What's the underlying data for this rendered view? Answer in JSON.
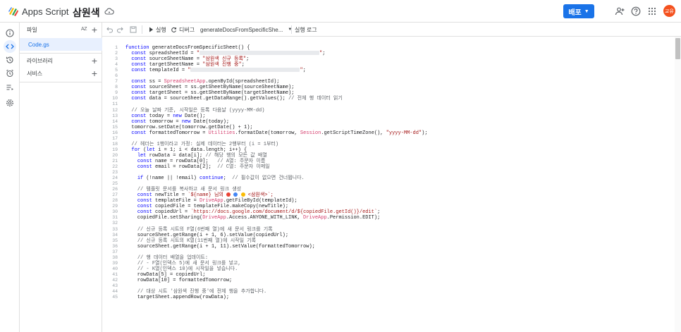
{
  "header": {
    "app_name": "Apps Script",
    "project_name": "삼원색",
    "deploy_label": "배포",
    "avatar_label": "교유"
  },
  "files_panel": {
    "files_label": "파일",
    "sort_label": "AZ",
    "active_file": "Code.gs",
    "libraries_label": "라이브러리",
    "services_label": "서비스"
  },
  "toolbar": {
    "run_label": "실행",
    "debug_label": "디버그",
    "function_name": "generateDocsFromSpecificShe...",
    "exec_log_label": "실행 로그"
  },
  "code_lines": [
    "function generateDocsFromSpecificSheet() {",
    "  const spreadsheetId = \"",
    "  const sourceSheetName = \"삼원색 신규 등록\";",
    "  const targetSheetName = \"삼원색 진행 중\";",
    "  const templateId = \"",
    "",
    "  const ss = SpreadsheetApp.openById(spreadsheetId);",
    "  const sourceSheet = ss.getSheetByName(sourceSheetName);",
    "  const targetSheet = ss.getSheetByName(targetSheetName);",
    "  const data = sourceSheet.getDataRange().getValues(); // 전체 행 데이터 읽기",
    "",
    "  // 오늘 날짜 기준, 시작일은 등록 다음날 (yyyy-MM-dd)",
    "  const today = new Date();",
    "  const tomorrow = new Date(today);",
    "  tomorrow.setDate(tomorrow.getDate() + 1);",
    "  const formattedTomorrow = Utilities.formatDate(tomorrow, Session.getScriptTimeZone(), \"yyyy-MM-dd\");",
    "",
    "  // 헤더는 1행이라고 가정: 실제 데이터는 2행부터 (i = 1부터)",
    "  for (let i = 1; i < data.length; i++) {",
    "    let rowData = data[i]; // 해당 행의 모든 값 배열",
    "    const name = rowData[0];   // A열: 주문자 이름",
    "    const email = rowData[2];  // C열: 주문자 이메일",
    "",
    "    if (!name || !email) continue;  // 필수값이 없으면 건너뜁니다.",
    "",
    "    // 템플릿 문서를 복사하고 새 문서 링크 생성",
    "    const newTitle = `${name} 님의 ",
    "    const templateFile = DriveApp.getFileById(templateId);",
    "    const copiedFile = templateFile.makeCopy(newTitle);",
    "    const copiedUrl = `https://docs.google.com/document/d/${copiedFile.getId()}/edit`;",
    "    copiedFile.setSharing(DriveApp.Access.ANYONE_WITH_LINK, DriveApp.Permission.EDIT);",
    "",
    "    // 신규 등록 시트의 F열(6번째 열)에 새 문서 링크를 기록",
    "    sourceSheet.getRange(i + 1, 6).setValue(copiedUrl);",
    "    // 신규 등록 시트의 K열(11번째 열)에 시작일 기록",
    "    sourceSheet.getRange(i + 1, 11).setValue(formattedTomorrow);",
    "",
    "    // 행 데이터 배열을 업데이트:",
    "    // - F열(인덱스 5)에 새 문서 링크를 넣고,",
    "    // - K열(인덱스 10)에 시작일을 넣습니다.",
    "    rowData[5] = copiedUrl;",
    "    rowData[10] = formattedTomorrow;",
    "",
    "    // 대상 시트 '삼원색 진행 중'에 전체 행을 추가합니다.",
    "    targetSheet.appendRow(rowData);"
  ],
  "line_numbers": [
    "1",
    "2",
    "3",
    "4",
    "5",
    "6",
    "7",
    "8",
    "9",
    "10",
    "11",
    "12",
    "13",
    "14",
    "15",
    "16",
    "17",
    "18",
    "19",
    "20",
    "21",
    "22",
    "23",
    "24",
    "25",
    "26",
    "27",
    "28",
    "29",
    "30",
    "31",
    "32",
    "33",
    "34",
    "35",
    "36",
    "37",
    "38",
    "39",
    "40",
    "41",
    "42",
    "43",
    "44",
    "45"
  ],
  "title_suffix": " <삼원색>`;",
  "colors": {
    "accent": "#1a73e8",
    "avatar": "#f4511e",
    "dot_red": "#ea4335",
    "dot_blue": "#4285f4",
    "dot_yellow": "#fbbc04"
  }
}
